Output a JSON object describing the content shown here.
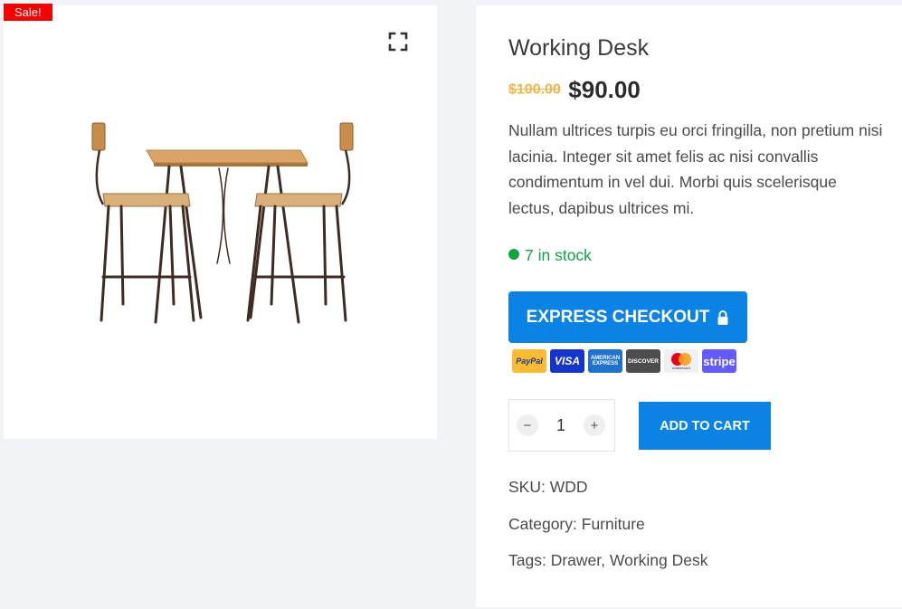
{
  "gallery": {
    "sale_badge": "Sale!",
    "zoom_icon": "fullscreen-icon",
    "image_alt": "table-and-chairs-image"
  },
  "product": {
    "title": "Working Desk",
    "price_old": "$100.00",
    "price_new": "$90.00",
    "description": "Nullam ultrices turpis eu orci fringilla, non pretium nisi lacinia. Integer sit amet felis ac nisi convallis condimentum in vel dui. Morbi quis scelerisque lectus, dapibus ultrices mi.",
    "stock": "7 in stock"
  },
  "checkout": {
    "express_label": "EXPRESS CHECKOUT",
    "payment_methods": [
      {
        "name": "PayPal",
        "icon": "paypal-icon"
      },
      {
        "name": "VISA",
        "icon": "visa-icon"
      },
      {
        "name": "AMERICAN EXPRESS",
        "icon": "amex-icon"
      },
      {
        "name": "DISCOVER",
        "icon": "discover-icon"
      },
      {
        "name": "mastercard",
        "icon": "mastercard-icon"
      },
      {
        "name": "stripe",
        "icon": "stripe-icon"
      }
    ]
  },
  "cart": {
    "quantity": "1",
    "minus_label": "−",
    "plus_label": "+",
    "add_label": "ADD TO CART"
  },
  "meta": {
    "sku_label": "SKU:",
    "sku_value": "WDD",
    "category_label": "Category:",
    "category_value": "Furniture",
    "tags_label": "Tags:",
    "tags": [
      "Drawer",
      "Working Desk"
    ]
  },
  "colors": {
    "accent": "#0a83e4",
    "sale": "#f70000",
    "stock": "#10a543",
    "old_price": "#f2b640"
  }
}
